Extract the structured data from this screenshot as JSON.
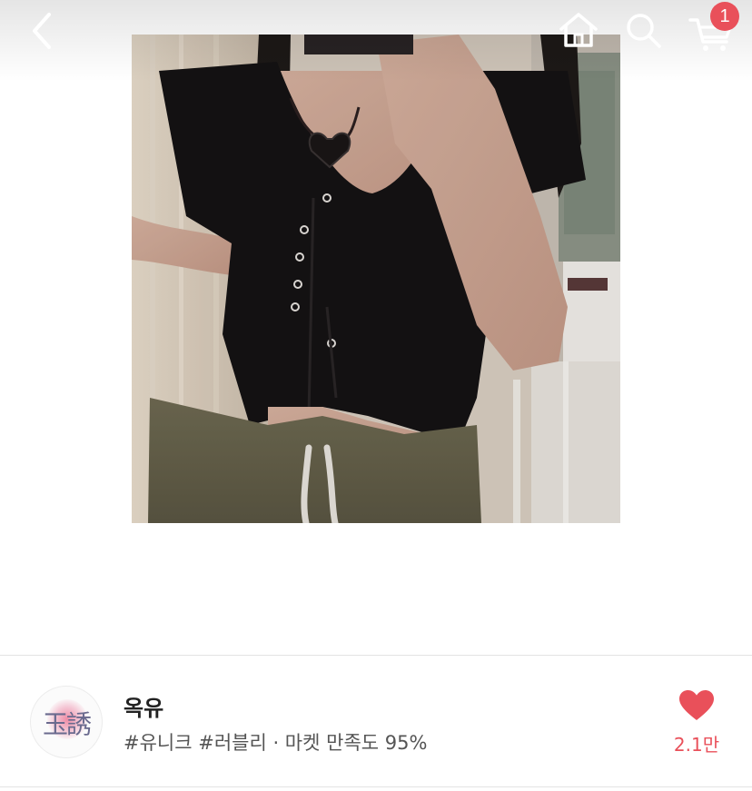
{
  "header": {
    "icons": [
      "chevron-left-icon",
      "home-icon",
      "search-icon",
      "cart-icon"
    ],
    "cart_badge": "1"
  },
  "shop": {
    "name": "옥유",
    "tags": "#유니크 #러블리 · 마켓 만족도 95%",
    "avatar_icon": "shop-logo",
    "avatar_text": "玉誘"
  },
  "likes": {
    "icon": "heart-icon",
    "count": "2.1만"
  },
  "colors": {
    "accent": "#e9505a",
    "divider": "#e3e3e3",
    "text_primary": "#222222",
    "text_secondary": "#555555"
  }
}
